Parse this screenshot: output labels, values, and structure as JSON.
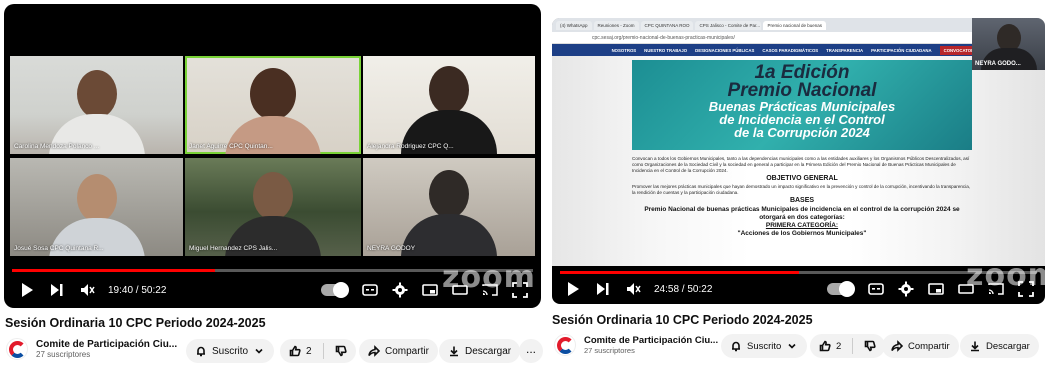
{
  "videos": [
    {
      "title": "Sesión Ordinaria 10 CPC Periodo 2024-2025",
      "time": "19:40 / 50:22",
      "progress": 0.39,
      "participants": [
        "Carolina Mendoza Polanco ...",
        "Janet Aguirre CPC Quintan...",
        "Alejandra Rodriguez CPC Q...",
        "Josué Sosa CPC Quintana R...",
        "Miguel Hernandez CPS Jalis...",
        "NEYRA GODOY"
      ],
      "watermark": "zoom",
      "channel": {
        "name": "Comite de Participación Ciu...",
        "subs": "27 suscriptores"
      },
      "subscribe_label": "Suscrito",
      "likes": "2",
      "share_label": "Compartir",
      "download_label": "Descargar",
      "more_label": "..."
    },
    {
      "title": "Sesión Ordinaria 10 CPC Periodo 2024-2025",
      "time": "24:58 / 50:22",
      "progress": 0.5,
      "pip_name": "NEYRA GODO...",
      "browser_tabs": [
        "(4) WhatsApp",
        "Reuniones - Zoom",
        "CPC QUINTANA ROO",
        "CPS Jalisco - Comite de Par...",
        "Premio nacional de buenas"
      ],
      "url": "cpc.sesaj.org/premio-nacional-de-buenas-practicas-municipales/",
      "site_nav": [
        "NOSOTROS",
        "NUESTRO TRABAJO",
        "DESIGNACIONES PÚBLICAS",
        "CASOS PARADIGMÁTICOS",
        "TRANSPARENCIA",
        "PARTICIPACIÓN CIUDADANA",
        "CONVOCATORIAS"
      ],
      "poster": {
        "line1": "1a Edición",
        "line2": "Premio Nacional",
        "line3": "Buenas Prácticas Municipales",
        "line4": "de Incidencia en el Control",
        "line5": "de la Corrupción 2024"
      },
      "doc": {
        "intro": "Convocan a todos los Gobiernos Municipales, tanto a las dependencias municipales como a las entidades auxiliares y los Organismos Públicos Descentralizados, así como Organizaciones de la Sociedad Civil y la sociedad en general a participar en la Primera Edición del Premio Nacional de Buenas Prácticas Municipales de Incidencia en el Control de la Corrupción 2024.",
        "objective_heading": "OBJETIVO GENERAL",
        "objective": "Promover las mejores prácticas municipales que hayan demostrado un impacto significativo en la prevención y control de la corrupción, incentivando la transparencia, la rendición de cuentas y la participación ciudadana.",
        "bases_heading": "BASES",
        "bases": "Premio Nacional de buenas prácticas Municipales de incidencia en el control de la corrupción 2024 se otorgará en dos categorías:",
        "category": "PRIMERA CATEGORÍA:",
        "category_desc": "\"Acciones de los Gobiernos Municipales\""
      },
      "watermark": "zoom",
      "channel": {
        "name": "Comite de Participación Ciu...",
        "subs": "27 suscriptores"
      },
      "subscribe_label": "Suscrito",
      "likes": "2",
      "share_label": "Compartir",
      "download_label": "Descargar",
      "more_label": "..."
    }
  ],
  "colors": {
    "progress": "#ff0000",
    "active_speaker": "#7ad337",
    "pill_bg": "#f2f2f2"
  }
}
